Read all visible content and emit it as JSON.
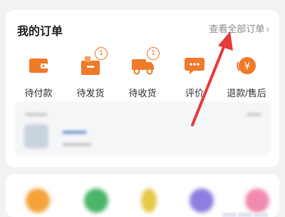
{
  "orders": {
    "title": "我的订单",
    "view_all": "查看全部订单",
    "chevron": "›",
    "items": [
      {
        "label": "待付款",
        "icon": "wallet-icon",
        "badge": ""
      },
      {
        "label": "待发货",
        "icon": "shipment-box-icon",
        "badge": "1"
      },
      {
        "label": "待收货",
        "icon": "delivery-truck-icon",
        "badge": "1"
      },
      {
        "label": "评价",
        "icon": "comment-bubble-icon",
        "badge": ""
      },
      {
        "label": "退款/售后",
        "icon": "refund-yen-icon",
        "badge": ""
      }
    ]
  },
  "colors": {
    "accent": "#f07a2a",
    "arrow": "#e83a3a"
  }
}
